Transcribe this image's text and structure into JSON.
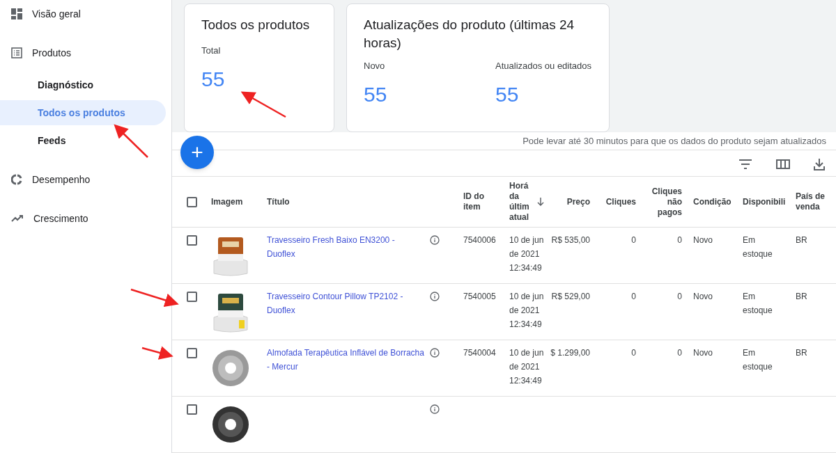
{
  "sidebar": {
    "items": [
      {
        "label": "Visão geral",
        "kind": "top",
        "selected": false
      },
      {
        "label": "Produtos",
        "kind": "top",
        "selected": false
      },
      {
        "label": "Diagnóstico",
        "kind": "sub",
        "selected": false
      },
      {
        "label": "Todos os produtos",
        "kind": "sub",
        "selected": true
      },
      {
        "label": "Feeds",
        "kind": "sub",
        "selected": false
      },
      {
        "label": "Desempenho",
        "kind": "top",
        "selected": false
      },
      {
        "label": "Crescimento",
        "kind": "top",
        "selected": false
      }
    ]
  },
  "summary_cards": [
    {
      "title": "Todos os produtos",
      "stats": [
        {
          "label": "Total",
          "value": "55"
        }
      ]
    },
    {
      "title": "Atualizações do produto (últimas 24 horas)",
      "stats": [
        {
          "label": "Novo",
          "value": "55"
        },
        {
          "label": "Atualizados ou editados",
          "value": "55"
        }
      ]
    }
  ],
  "update_note": "Pode levar até 30 minutos para que os dados do produto sejam atualizados",
  "add_button": "+",
  "table": {
    "select_all_checked": false,
    "columns": [
      "Imagem",
      "Título",
      "ID do item",
      "Horá da últim atual",
      "Preço",
      "Cliques",
      "Cliques não pagos",
      "Condição",
      "Disponibili",
      "País de venda"
    ],
    "rows": [
      {
        "checked": false,
        "title": "Travesseiro Fresh Baixo EN3200 - Duoflex",
        "id": "7540006",
        "time": "10 de jun de 2021 12:34:49",
        "price": "R$ 535,00",
        "clicks": "0",
        "unpaid_clicks": "0",
        "condition": "Novo",
        "availability": "Em estoque",
        "country": "BR"
      },
      {
        "checked": false,
        "title": "Travesseiro Contour Pillow TP2102 - Duoflex",
        "id": "7540005",
        "time": "10 de jun de 2021 12:34:49",
        "price": "R$ 529,00",
        "clicks": "0",
        "unpaid_clicks": "0",
        "condition": "Novo",
        "availability": "Em estoque",
        "country": "BR"
      },
      {
        "checked": false,
        "title": "Almofada Terapêutica Inflável de Borracha - Mercur",
        "id": "7540004",
        "time": "10 de jun de 2021 12:34:49",
        "price": "$ 1.299,00",
        "clicks": "0",
        "unpaid_clicks": "0",
        "condition": "Novo",
        "availability": "Em estoque",
        "country": "BR"
      },
      {
        "checked": false
      }
    ]
  }
}
